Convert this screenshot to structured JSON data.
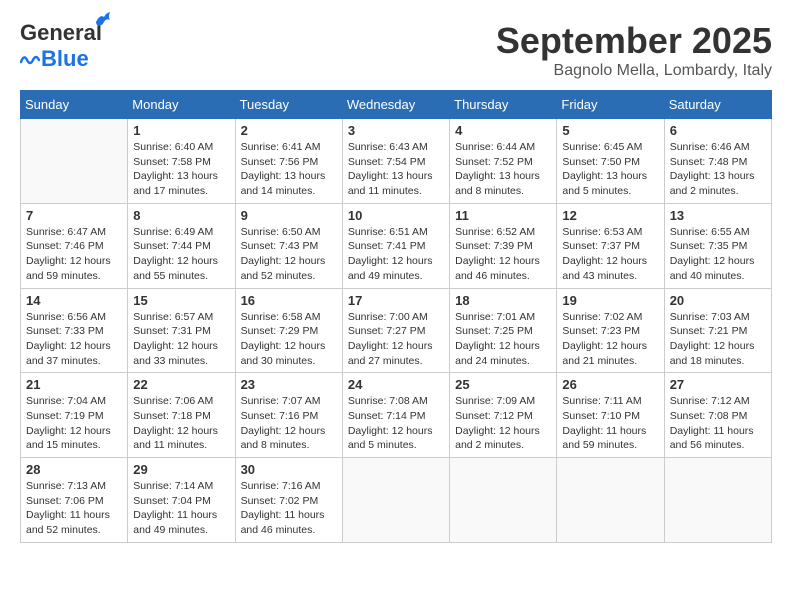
{
  "header": {
    "logo_line1": "General",
    "logo_line2": "Blue",
    "month": "September 2025",
    "location": "Bagnolo Mella, Lombardy, Italy"
  },
  "weekdays": [
    "Sunday",
    "Monday",
    "Tuesday",
    "Wednesday",
    "Thursday",
    "Friday",
    "Saturday"
  ],
  "weeks": [
    [
      {
        "day": "",
        "info": ""
      },
      {
        "day": "1",
        "info": "Sunrise: 6:40 AM\nSunset: 7:58 PM\nDaylight: 13 hours\nand 17 minutes."
      },
      {
        "day": "2",
        "info": "Sunrise: 6:41 AM\nSunset: 7:56 PM\nDaylight: 13 hours\nand 14 minutes."
      },
      {
        "day": "3",
        "info": "Sunrise: 6:43 AM\nSunset: 7:54 PM\nDaylight: 13 hours\nand 11 minutes."
      },
      {
        "day": "4",
        "info": "Sunrise: 6:44 AM\nSunset: 7:52 PM\nDaylight: 13 hours\nand 8 minutes."
      },
      {
        "day": "5",
        "info": "Sunrise: 6:45 AM\nSunset: 7:50 PM\nDaylight: 13 hours\nand 5 minutes."
      },
      {
        "day": "6",
        "info": "Sunrise: 6:46 AM\nSunset: 7:48 PM\nDaylight: 13 hours\nand 2 minutes."
      }
    ],
    [
      {
        "day": "7",
        "info": "Sunrise: 6:47 AM\nSunset: 7:46 PM\nDaylight: 12 hours\nand 59 minutes."
      },
      {
        "day": "8",
        "info": "Sunrise: 6:49 AM\nSunset: 7:44 PM\nDaylight: 12 hours\nand 55 minutes."
      },
      {
        "day": "9",
        "info": "Sunrise: 6:50 AM\nSunset: 7:43 PM\nDaylight: 12 hours\nand 52 minutes."
      },
      {
        "day": "10",
        "info": "Sunrise: 6:51 AM\nSunset: 7:41 PM\nDaylight: 12 hours\nand 49 minutes."
      },
      {
        "day": "11",
        "info": "Sunrise: 6:52 AM\nSunset: 7:39 PM\nDaylight: 12 hours\nand 46 minutes."
      },
      {
        "day": "12",
        "info": "Sunrise: 6:53 AM\nSunset: 7:37 PM\nDaylight: 12 hours\nand 43 minutes."
      },
      {
        "day": "13",
        "info": "Sunrise: 6:55 AM\nSunset: 7:35 PM\nDaylight: 12 hours\nand 40 minutes."
      }
    ],
    [
      {
        "day": "14",
        "info": "Sunrise: 6:56 AM\nSunset: 7:33 PM\nDaylight: 12 hours\nand 37 minutes."
      },
      {
        "day": "15",
        "info": "Sunrise: 6:57 AM\nSunset: 7:31 PM\nDaylight: 12 hours\nand 33 minutes."
      },
      {
        "day": "16",
        "info": "Sunrise: 6:58 AM\nSunset: 7:29 PM\nDaylight: 12 hours\nand 30 minutes."
      },
      {
        "day": "17",
        "info": "Sunrise: 7:00 AM\nSunset: 7:27 PM\nDaylight: 12 hours\nand 27 minutes."
      },
      {
        "day": "18",
        "info": "Sunrise: 7:01 AM\nSunset: 7:25 PM\nDaylight: 12 hours\nand 24 minutes."
      },
      {
        "day": "19",
        "info": "Sunrise: 7:02 AM\nSunset: 7:23 PM\nDaylight: 12 hours\nand 21 minutes."
      },
      {
        "day": "20",
        "info": "Sunrise: 7:03 AM\nSunset: 7:21 PM\nDaylight: 12 hours\nand 18 minutes."
      }
    ],
    [
      {
        "day": "21",
        "info": "Sunrise: 7:04 AM\nSunset: 7:19 PM\nDaylight: 12 hours\nand 15 minutes."
      },
      {
        "day": "22",
        "info": "Sunrise: 7:06 AM\nSunset: 7:18 PM\nDaylight: 12 hours\nand 11 minutes."
      },
      {
        "day": "23",
        "info": "Sunrise: 7:07 AM\nSunset: 7:16 PM\nDaylight: 12 hours\nand 8 minutes."
      },
      {
        "day": "24",
        "info": "Sunrise: 7:08 AM\nSunset: 7:14 PM\nDaylight: 12 hours\nand 5 minutes."
      },
      {
        "day": "25",
        "info": "Sunrise: 7:09 AM\nSunset: 7:12 PM\nDaylight: 12 hours\nand 2 minutes."
      },
      {
        "day": "26",
        "info": "Sunrise: 7:11 AM\nSunset: 7:10 PM\nDaylight: 11 hours\nand 59 minutes."
      },
      {
        "day": "27",
        "info": "Sunrise: 7:12 AM\nSunset: 7:08 PM\nDaylight: 11 hours\nand 56 minutes."
      }
    ],
    [
      {
        "day": "28",
        "info": "Sunrise: 7:13 AM\nSunset: 7:06 PM\nDaylight: 11 hours\nand 52 minutes."
      },
      {
        "day": "29",
        "info": "Sunrise: 7:14 AM\nSunset: 7:04 PM\nDaylight: 11 hours\nand 49 minutes."
      },
      {
        "day": "30",
        "info": "Sunrise: 7:16 AM\nSunset: 7:02 PM\nDaylight: 11 hours\nand 46 minutes."
      },
      {
        "day": "",
        "info": ""
      },
      {
        "day": "",
        "info": ""
      },
      {
        "day": "",
        "info": ""
      },
      {
        "day": "",
        "info": ""
      }
    ]
  ]
}
